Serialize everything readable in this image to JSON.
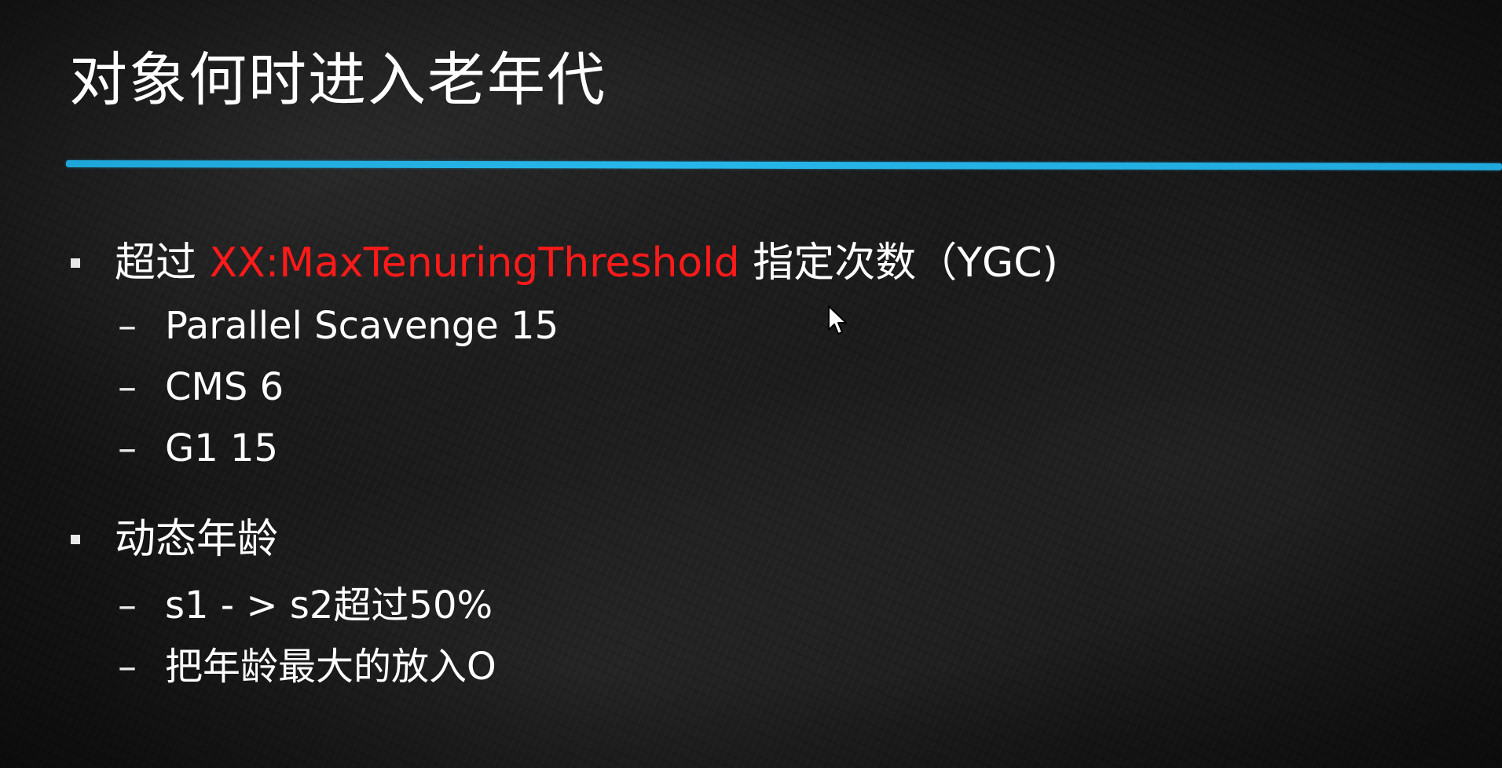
{
  "slide": {
    "title": "对象何时进入老年代",
    "accent_color": "#1fa6d8",
    "highlight_color": "#ff1a1a",
    "bullets": [
      {
        "prefix": "超过 ",
        "highlight": "XX:MaxTenuringThreshold",
        "suffix": " 指定次数（YGC)",
        "subitems": [
          "Parallel Scavenge 15",
          "CMS 6",
          "G1 15"
        ]
      },
      {
        "prefix": "动态年龄",
        "highlight": "",
        "suffix": "",
        "subitems": [
          "s1 - > s2超过50%",
          "把年龄最大的放入O"
        ]
      }
    ],
    "bullet_marker_icon": "square-bullet-icon",
    "sub_marker": "–",
    "cursor_icon": "mouse-pointer-icon"
  }
}
